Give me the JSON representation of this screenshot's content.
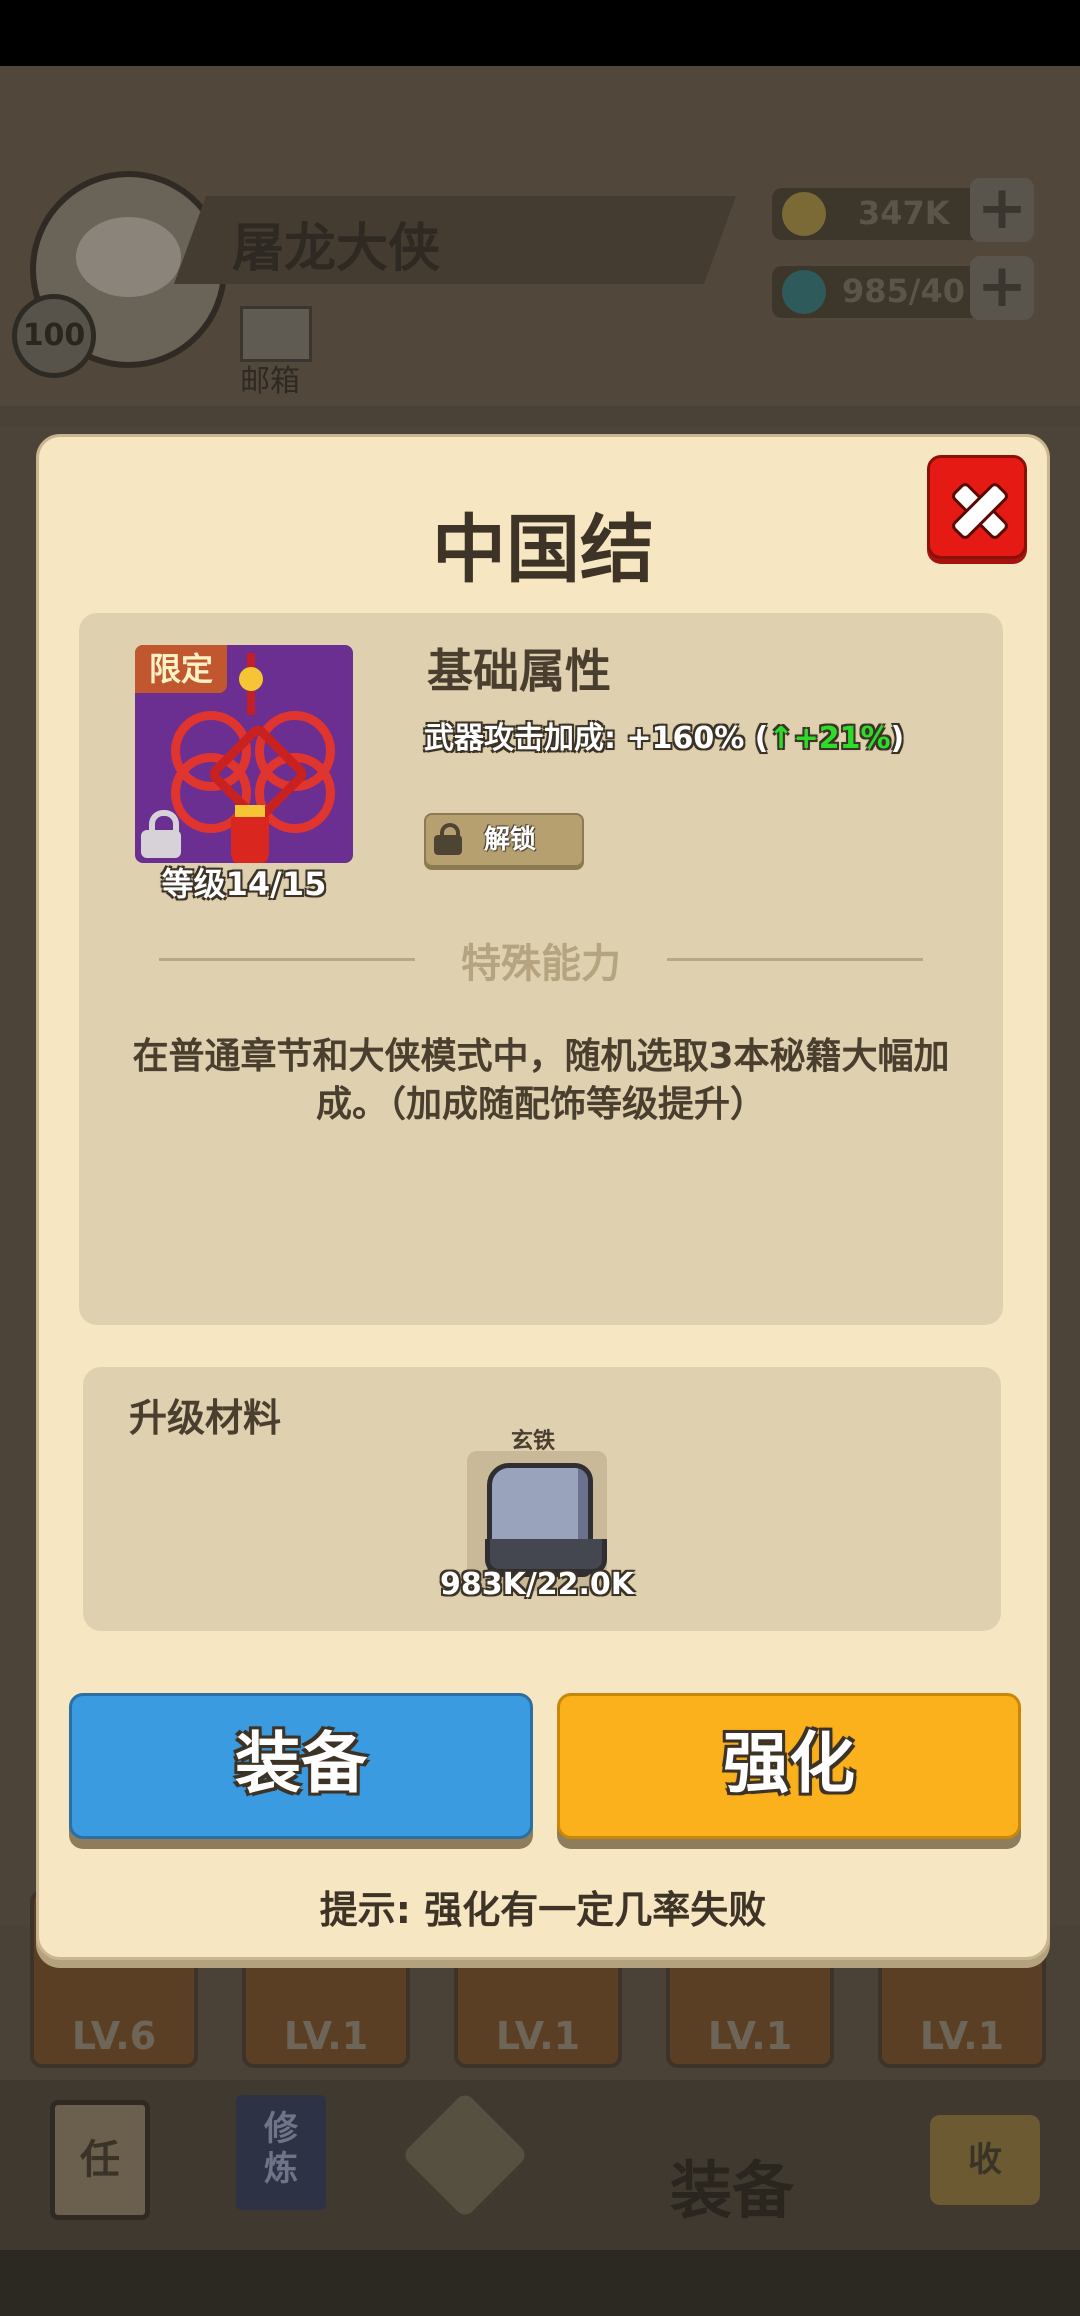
{
  "background": {
    "player": {
      "name": "屠龙大侠",
      "level": "100",
      "mail_label": "邮箱"
    },
    "resources": [
      {
        "icon": "coin-icon",
        "value": "347K"
      },
      {
        "icon": "gem-icon",
        "value": "985/40"
      }
    ],
    "equipment_levels": [
      "LV.6",
      "LV.1",
      "LV.1",
      "LV.1",
      "LV.1"
    ],
    "nav": {
      "quest_char": "任",
      "train_label": "修炼",
      "equip_label": "装备",
      "collect_char": "收"
    }
  },
  "modal": {
    "title": "中国结",
    "item": {
      "badge": "限定",
      "level": "等级14/15",
      "icon": "chinese-knot-icon"
    },
    "base_attr": {
      "title": "基础属性",
      "prefix": "武器攻击加成: +160% (",
      "arrow": "↑",
      "increase": "+21%",
      "suffix": ")"
    },
    "unlock_label": "解锁",
    "special": {
      "title": "特殊能力",
      "description": "在普通章节和大侠模式中，随机选取3本秘籍大幅加成。（加成随配饰等级提升）"
    },
    "materials": {
      "title": "升级材料",
      "item_name": "玄铁",
      "count": "983K/22.0K"
    },
    "buttons": {
      "equip": "装备",
      "enhance": "强化"
    },
    "tip": "提示: 强化有一定几率失败"
  },
  "colors": {
    "equip_button": "#3a9be0",
    "enhance_button": "#fbb11c",
    "close_button": "#e51a15",
    "increase_text": "#2ddb2a"
  }
}
